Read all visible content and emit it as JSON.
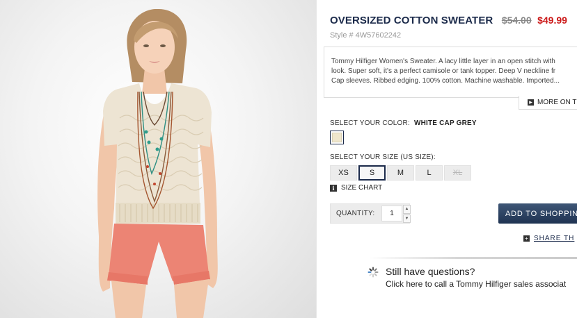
{
  "product": {
    "title": "OVERSIZED COTTON SWEATER",
    "old_price": "$54.00",
    "new_price": "$49.99",
    "style_number": "Style # 4W57602242",
    "description_lines": [
      "Tommy Hilfiger Women's Sweater. A lacy little layer in an open stitch with",
      "look. Super soft, it's a perfect camisole or tank topper. Deep V neckline fr",
      "Cap sleeves. Ribbed edging. 100% cotton. Machine washable. Imported..."
    ],
    "more_label": "MORE ON T"
  },
  "color": {
    "label": "SELECT YOUR COLOR:",
    "selected": "WHITE CAP GREY",
    "swatch_hex": "#efe6cc"
  },
  "size": {
    "label": "SELECT YOUR SIZE (US SIZE):",
    "options": [
      "XS",
      "S",
      "M",
      "L",
      "XL"
    ],
    "selected": "S",
    "unavailable": [
      "XL"
    ],
    "chart_label": "SIZE CHART"
  },
  "quantity": {
    "label": "QUANTITY:",
    "value": "1"
  },
  "actions": {
    "add_to_bag": "ADD TO SHOPPING",
    "share": "SHARE TH"
  },
  "help": {
    "title": "Still have questions?",
    "subtitle": "Click here to call a Tommy Hilfiger sales associat"
  },
  "colors": {
    "navy": "#1b2a4a",
    "sale_red": "#cc1a1a",
    "button_grey": "#ececec"
  }
}
